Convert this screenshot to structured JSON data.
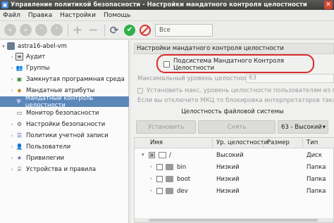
{
  "window": {
    "title": "Управление политикой безопасности - Настройки мандатного контроля целостности",
    "close_glyph": "✕"
  },
  "menu": [
    "Файл",
    "Правка",
    "Настройки",
    "Помощь"
  ],
  "toolbar": {
    "filter_value": "Все",
    "icons": [
      "back-icon",
      "forward-icon",
      "up-icon",
      "down-icon",
      "add-icon",
      "remove-icon",
      "refresh-icon",
      "apply-icon",
      "cancel-icon"
    ]
  },
  "tree": {
    "root": "astra16-abel-vm",
    "items": [
      {
        "label": "Аудит",
        "icon": "audit-icon"
      },
      {
        "label": "Группы",
        "icon": "groups-icon"
      },
      {
        "label": "Замкнутая программная среда",
        "icon": "closed-env-icon"
      },
      {
        "label": "Мандатные атрибуты",
        "icon": "mandatory-attrs-icon"
      },
      {
        "label": "Мандатный контроль целостности",
        "icon": "integrity-icon"
      },
      {
        "label": "Монитор безопасности",
        "icon": "monitor-icon"
      },
      {
        "label": "Настройки безопасности",
        "icon": "security-settings-icon"
      },
      {
        "label": "Политики учетной записи",
        "icon": "account-policy-icon"
      },
      {
        "label": "Пользователи",
        "icon": "users-icon"
      },
      {
        "label": "Привилегии",
        "icon": "privileges-icon"
      },
      {
        "label": "Устройства и правила",
        "icon": "devices-icon"
      }
    ],
    "selected_index": 4
  },
  "panel": {
    "header": "Настройки мандатного контроля целостности",
    "mac_checkbox_label": "Подсистема Мандатного Контроля Целостности",
    "max_level_label": "Максимальный уровень целостности",
    "max_level_value": "63",
    "option1": "Установить макс. уровень целостности пользователям из группы astra",
    "option2": "Если вы отключите МКЦ то блокировка интерпретаторов также будет",
    "fs_caption": "Целостность файловой системы",
    "btn_set": "Установить",
    "btn_remove": "Снять",
    "level_select": "63 - Высокий",
    "columns": [
      "Имя",
      "Ур. целостности",
      "Размер",
      "Тип"
    ],
    "rows": [
      {
        "name": "/",
        "level": "Высокий",
        "size": "",
        "type": "Диск"
      },
      {
        "name": "bin",
        "level": "Низкий",
        "size": "",
        "type": "Папка"
      },
      {
        "name": "boot",
        "level": "Низкий",
        "size": "",
        "type": "Папка"
      },
      {
        "name": "dev",
        "level": "Низкий",
        "size": "",
        "type": "Папка"
      }
    ]
  }
}
